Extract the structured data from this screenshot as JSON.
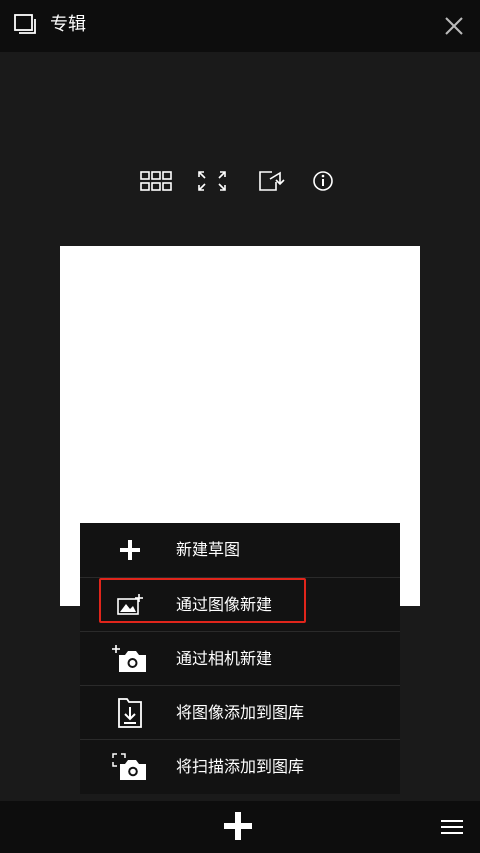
{
  "header": {
    "title": "专辑",
    "left_icon": "album-icon",
    "right_icon": "close-icon"
  },
  "toolbar": {
    "icons": [
      "grid-view-icon",
      "fullscreen-icon",
      "export-icon",
      "info-icon"
    ]
  },
  "add_menu": {
    "items": [
      {
        "label": "新建草图",
        "icon": "plus-icon"
      },
      {
        "label": "通过图像新建",
        "icon": "image-add-icon"
      },
      {
        "label": "通过相机新建",
        "icon": "camera-add-icon"
      },
      {
        "label": "将图像添加到图库",
        "icon": "folder-import-icon"
      },
      {
        "label": "将扫描添加到图库",
        "icon": "scan-camera-icon"
      }
    ]
  },
  "bottom_bar": {
    "center_icon": "plus-icon",
    "right_icon": "hamburger-menu-icon"
  },
  "colors": {
    "background": "#1a1a1a",
    "bars": "#0d0d0d",
    "menu": "#121212",
    "highlight": "#e0251b",
    "canvas": "#ffffff"
  }
}
